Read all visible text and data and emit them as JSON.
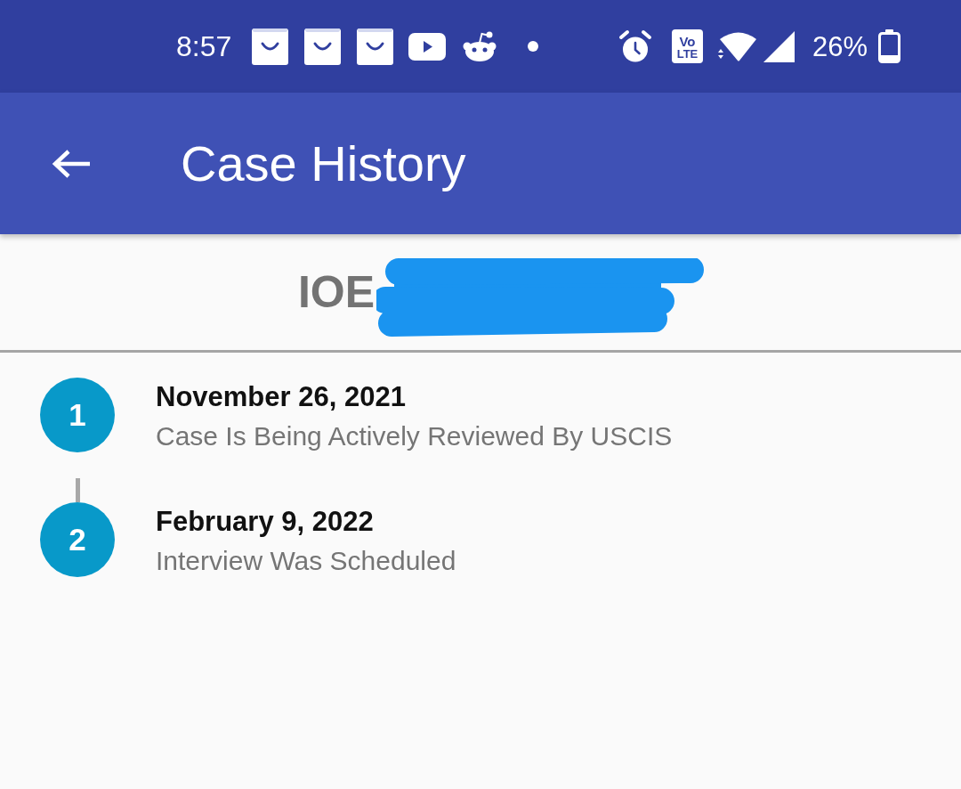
{
  "status_bar": {
    "time": "8:57",
    "network_badge": {
      "top": "Vo",
      "bottom": "LTE"
    },
    "battery": "26%"
  },
  "app_bar": {
    "title": "Case History"
  },
  "case_number": {
    "text": "IOE",
    "redacted": true
  },
  "history": [
    {
      "number": "1",
      "date": "November 26, 2021",
      "status": "Case Is Being Actively Reviewed By USCIS"
    },
    {
      "number": "2",
      "date": "February 9, 2022",
      "status": "Interview Was Scheduled"
    }
  ]
}
